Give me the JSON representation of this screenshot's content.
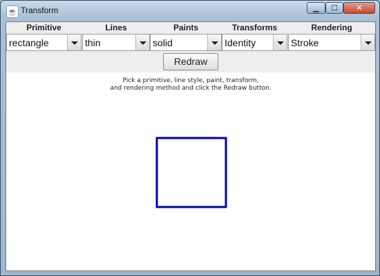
{
  "window": {
    "title": "Transform",
    "app_icon": "java-icon",
    "controls": {
      "minimize": "minimize-icon",
      "maximize": "maximize-icon",
      "close": "close-icon"
    }
  },
  "controls": [
    {
      "label": "Primitive",
      "value": "rectangle"
    },
    {
      "label": "Lines",
      "value": "thin"
    },
    {
      "label": "Paints",
      "value": "solid"
    },
    {
      "label": "Transforms",
      "value": "Identity"
    },
    {
      "label": "Rendering",
      "value": "Stroke"
    }
  ],
  "redraw_label": "Redraw",
  "instructions": {
    "line1": "Pick a primitive, line style, paint, transform,",
    "line2": "and rendering method and click the Redraw button."
  },
  "drawing": {
    "shape": "rectangle",
    "rendering": "stroke",
    "stroke_color": "#0000aa"
  }
}
